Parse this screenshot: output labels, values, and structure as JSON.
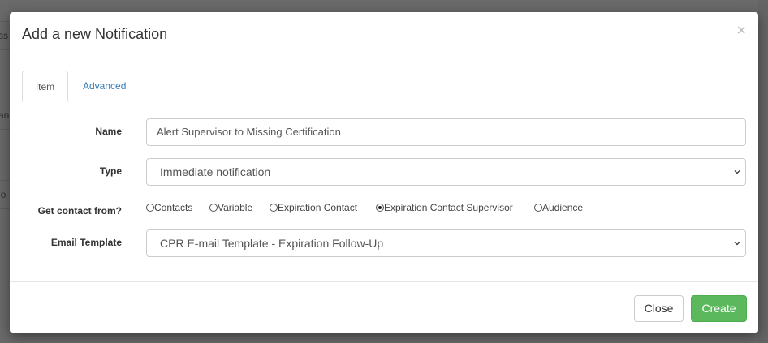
{
  "background": {
    "fragments": [
      "ss",
      "an",
      "io"
    ]
  },
  "modal": {
    "title": "Add a new Notification",
    "close_glyph": "×",
    "tabs": [
      {
        "label": "Item",
        "active": true
      },
      {
        "label": "Advanced",
        "active": false
      }
    ],
    "form": {
      "name": {
        "label": "Name",
        "value": "Alert Supervisor to Missing Certification"
      },
      "type": {
        "label": "Type",
        "value": "Immediate notification"
      },
      "contact_from": {
        "label": "Get contact from?",
        "options": [
          {
            "label": "Contacts",
            "checked": false
          },
          {
            "label": "Variable",
            "checked": false
          },
          {
            "label": "Expiration Contact",
            "checked": false
          },
          {
            "label": "Expiration Contact Supervisor",
            "checked": true
          },
          {
            "label": "Audience",
            "checked": false
          }
        ]
      },
      "email_template": {
        "label": "Email Template",
        "value": "CPR E-mail Template - Expiration Follow-Up"
      }
    },
    "footer": {
      "close_label": "Close",
      "create_label": "Create"
    }
  },
  "colors": {
    "accent_link": "#337ab7",
    "create_button": "#5cb85c",
    "overlay": "#6f6f6f"
  },
  "icons": {
    "close": "close-icon",
    "select_chevron": "chevron-down-icon",
    "radio": "radio-icon"
  }
}
